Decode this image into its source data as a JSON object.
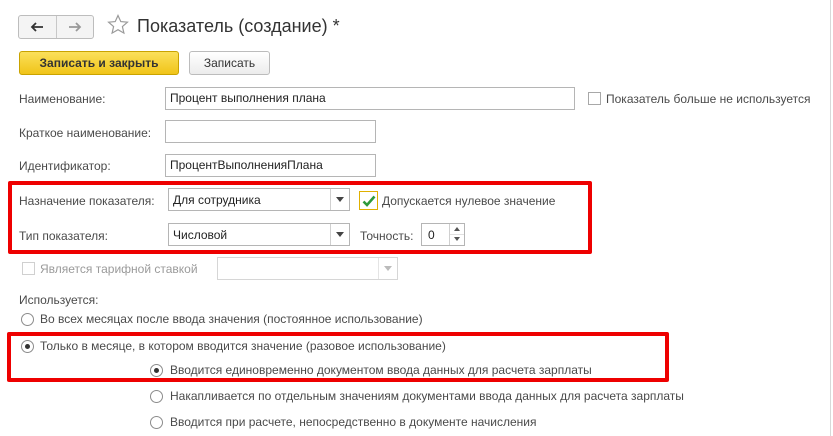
{
  "window": {
    "title": "Показатель (создание) *",
    "nav_back_icon": "arrow-left-icon",
    "nav_forward_icon": "arrow-right-icon",
    "favorite_icon": "star-icon"
  },
  "toolbar": {
    "save_close_label": "Записать и закрыть",
    "save_label": "Записать"
  },
  "form": {
    "name": {
      "label": "Наименование:",
      "value": "Процент выполнения плана"
    },
    "not_used": {
      "label": "Показатель больше не используется",
      "checked": false
    },
    "short_name": {
      "label": "Краткое наименование:",
      "value": ""
    },
    "identifier": {
      "label": "Идентификатор:",
      "value": "ПроцентВыполненияПлана"
    },
    "purpose": {
      "label": "Назначение показателя:",
      "value": "Для сотрудника"
    },
    "zero_allowed": {
      "label": "Допускается нулевое значение",
      "checked": true
    },
    "type": {
      "label": "Тип показателя:",
      "value": "Числовой"
    },
    "precision": {
      "label": "Точность:",
      "value": "0"
    },
    "tariff": {
      "label": "Является тарифной ставкой",
      "checked": false,
      "disabled": true,
      "value": ""
    },
    "usage": {
      "label": "Используется:",
      "options": [
        {
          "label": "Во всех месяцах после ввода значения (постоянное использование)",
          "selected": false
        },
        {
          "label": "Только в месяце, в котором вводится значение (разовое использование)",
          "selected": true
        }
      ],
      "sub_options": [
        {
          "label": "Вводится единовременно документом ввода данных для расчета зарплаты",
          "selected": true
        },
        {
          "label": "Накапливается по отдельным значениям документами ввода данных для расчета зарплаты",
          "selected": false
        },
        {
          "label": "Вводится при расчете, непосредственно в документе начисления",
          "selected": false
        }
      ]
    }
  },
  "colors": {
    "primary_button": "#f0c419",
    "highlight_border": "#ee0000",
    "checkbox_check": "#2e9a3c"
  }
}
